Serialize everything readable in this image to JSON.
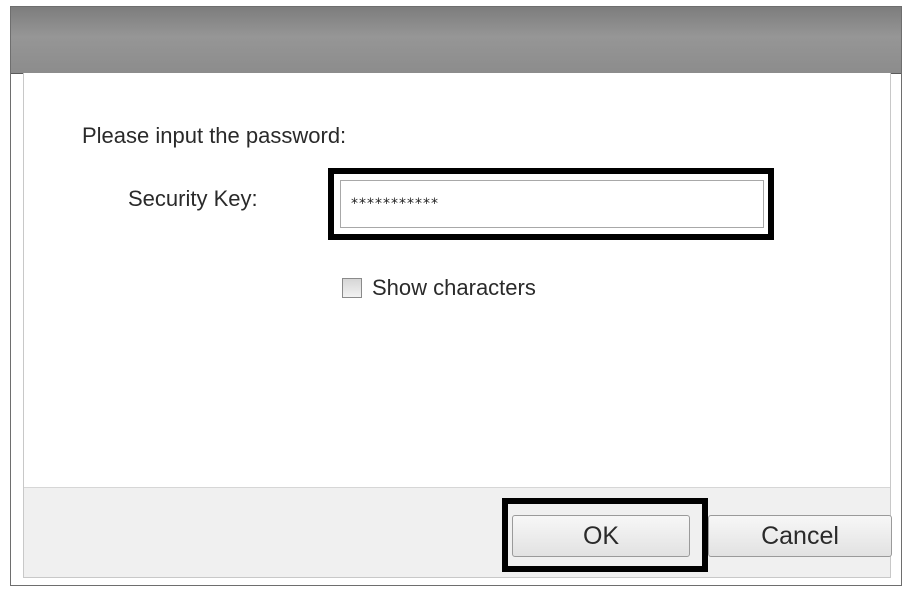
{
  "dialog": {
    "prompt": "Please input the password:",
    "security_key_label": "Security Key:",
    "security_key_value": "***********",
    "show_characters": {
      "label": "Show characters",
      "checked": false
    },
    "buttons": {
      "ok_label": "OK",
      "cancel_label": "Cancel"
    }
  }
}
